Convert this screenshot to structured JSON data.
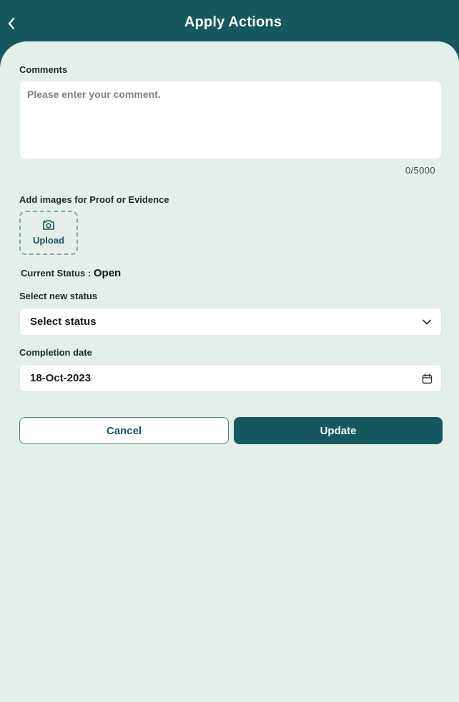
{
  "header": {
    "title": "Apply Actions",
    "back_icon": "chevron-left-icon"
  },
  "comments": {
    "label": "Comments",
    "value": "",
    "placeholder": "Please enter your comment.",
    "counter": "0/5000"
  },
  "evidence": {
    "label": "Add images for Proof or Evidence",
    "upload_label": "Upload",
    "upload_icon": "camera-icon"
  },
  "current_status": {
    "label": "Current Status :",
    "value": "Open"
  },
  "new_status": {
    "label": "Select new status",
    "selected": "Select status",
    "icon": "chevron-down-icon"
  },
  "completion_date": {
    "label": "Completion date",
    "value": "18-Oct-2023",
    "icon": "calendar-icon"
  },
  "actions": {
    "cancel_label": "Cancel",
    "update_label": "Update"
  },
  "colors": {
    "primary": "#15585f",
    "background": "#e5efe9",
    "surface": "#ffffff"
  }
}
